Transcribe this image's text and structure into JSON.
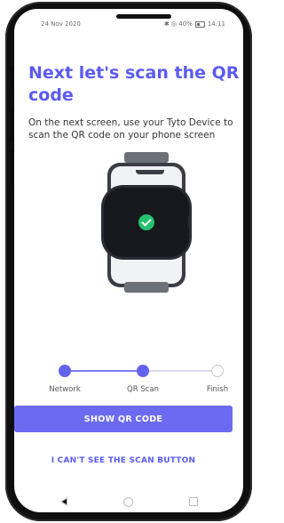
{
  "status_bar": {
    "date": "24 Nov 2020",
    "indicators": "✱ ◎ 40%",
    "time": "14:11",
    "battery_icon": "battery-icon"
  },
  "content": {
    "title": "Next let's scan the QR code",
    "description": "On the next screen, use your Tyto Device to scan the QR code on your phone screen",
    "illustration": {
      "icons": [
        "phone-icon",
        "watch-device-icon",
        "check-icon"
      ],
      "check_color": "#25c16f"
    }
  },
  "stepper": {
    "steps": [
      {
        "label": "Network",
        "state": "done"
      },
      {
        "label": "QR Scan",
        "state": "done"
      },
      {
        "label": "Finish",
        "state": "todo"
      }
    ]
  },
  "actions": {
    "primary_label": "SHOW QR CODE",
    "secondary_label": "I CAN'T SEE THE SCAN BUTTON"
  },
  "navbar": {
    "icons": [
      "back-icon",
      "home-icon",
      "recents-icon"
    ]
  },
  "colors": {
    "accent": "#6b6af1",
    "title": "#5b5bf0",
    "phone_frame": "#0f0f10"
  }
}
